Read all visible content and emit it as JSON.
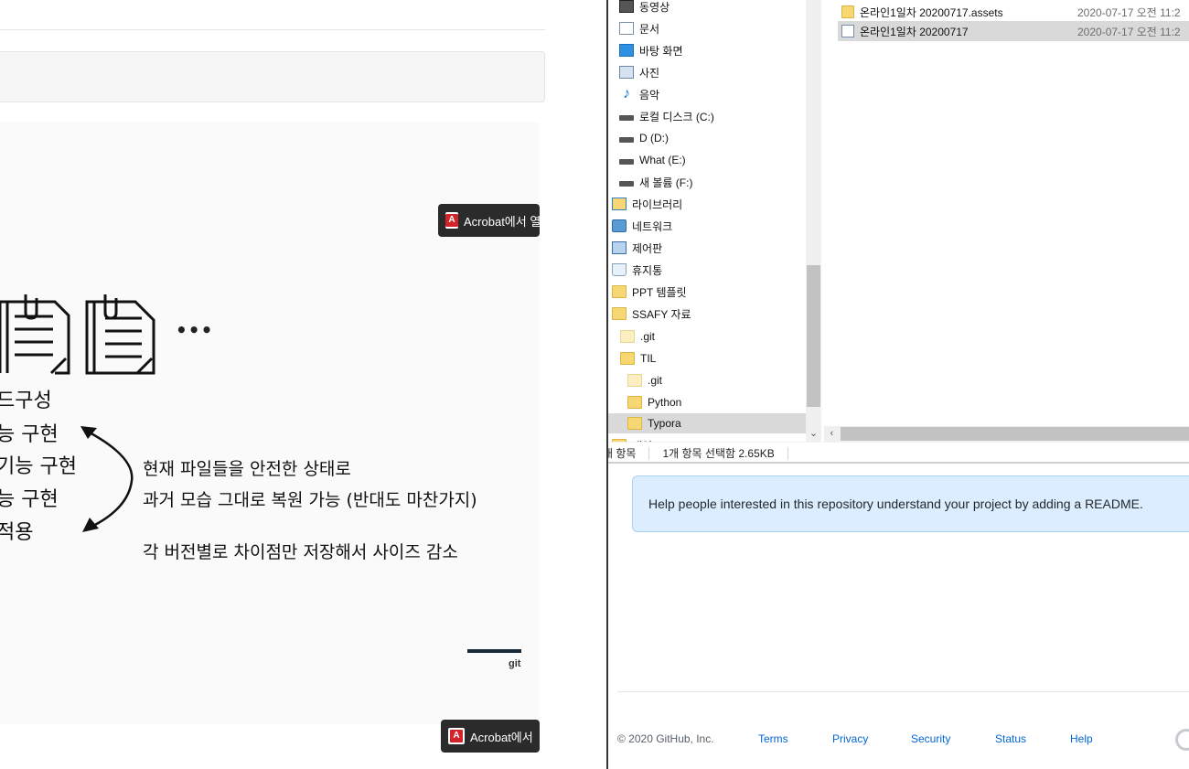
{
  "pdf_viewer": {
    "acrobat_button_top": "Acrobat에서 열",
    "acrobat_button_bottom": "Acrobat에서",
    "slide": {
      "items": [
        "드구성",
        "능 구현",
        "기능 구현",
        "능 구현",
        "적용"
      ],
      "ellipsis": "•••",
      "notes": [
        "현재 파일들을 안전한 상태로",
        "과거 모습 그대로 복원 가능 (반대도 마찬가지)",
        "각 버전별로 차이점만 저장해서 사이즈 감소"
      ],
      "logo_label": "git"
    }
  },
  "explorer": {
    "tree": [
      {
        "label": "동영상",
        "icon": "video-icon"
      },
      {
        "label": "문서",
        "icon": "document-icon"
      },
      {
        "label": "바탕 화면",
        "icon": "desktop-icon"
      },
      {
        "label": "사진",
        "icon": "pictures-icon"
      },
      {
        "label": "음악",
        "icon": "music-icon"
      },
      {
        "label": "로컬 디스크 (C:)",
        "icon": "drive-icon"
      },
      {
        "label": "D (D:)",
        "icon": "drive-icon"
      },
      {
        "label": "What (E:)",
        "icon": "drive-icon"
      },
      {
        "label": "새 볼륨 (F:)",
        "icon": "drive-icon"
      },
      {
        "label": "라이브러리",
        "icon": "library-icon"
      },
      {
        "label": "네트워크",
        "icon": "network-icon"
      },
      {
        "label": "제어판",
        "icon": "control-panel-icon"
      },
      {
        "label": "휴지통",
        "icon": "recycle-bin-icon"
      },
      {
        "label": "PPT 템플릿",
        "icon": "folder-icon"
      },
      {
        "label": "SSAFY 자료",
        "icon": "folder-icon"
      },
      {
        "label": ".git",
        "icon": "folder-icon"
      },
      {
        "label": "TIL",
        "icon": "folder-icon"
      },
      {
        "label": ".git",
        "icon": "folder-icon"
      },
      {
        "label": "Python",
        "icon": "folder-icon"
      },
      {
        "label": "Typora",
        "icon": "folder-icon"
      },
      {
        "label": "개인",
        "icon": "folder-icon"
      }
    ],
    "files": [
      {
        "name": "온라인1일차 20200717.assets",
        "date": "2020-07-17 오전 11:2",
        "icon": "folder-icon",
        "selected": false
      },
      {
        "name": "온라인1일차 20200717",
        "date": "2020-07-17 오전 11:2",
        "icon": "markdown-file-icon",
        "selected": true
      }
    ],
    "status": {
      "items_count": "개 항목",
      "selection": "1개 항목 선택함 2.65KB"
    }
  },
  "github": {
    "readme_prompt": "Help people interested in this repository understand your project by adding a README.",
    "footer": {
      "copyright": "© 2020 GitHub, Inc.",
      "links": [
        "Terms",
        "Privacy",
        "Security",
        "Status",
        "Help"
      ]
    }
  },
  "colors": {
    "readme_bg": "#dbedff",
    "link": "#0366d6",
    "selection_bg": "#d9d9d9",
    "folder": "#f7d774"
  }
}
